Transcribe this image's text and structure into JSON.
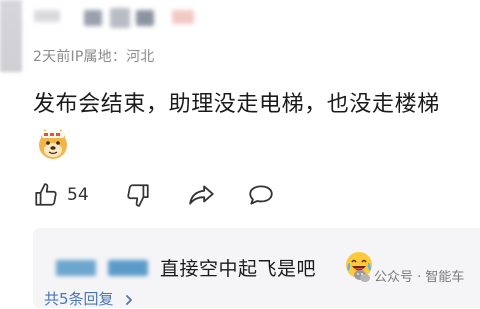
{
  "comment": {
    "meta": "2天前IP属地：河北",
    "text": "发布会结束，助理没走电梯，也没走楼梯",
    "emoji_name": "doge-emoji"
  },
  "actions": {
    "like_count": "54",
    "icons": [
      "thumbs-up-icon",
      "thumbs-down-icon",
      "share-icon",
      "comment-icon"
    ]
  },
  "reply": {
    "text": "直接空中起飞是吧",
    "emoji_name": "laughing-crying-emoji",
    "more_label": "共5条回复"
  },
  "watermark": {
    "text": "公众号 · 智能车"
  },
  "colors": {
    "link_blue": "#4a76b8",
    "meta_gray": "#8c8c8c",
    "reply_bg": "#f5f5f7"
  }
}
